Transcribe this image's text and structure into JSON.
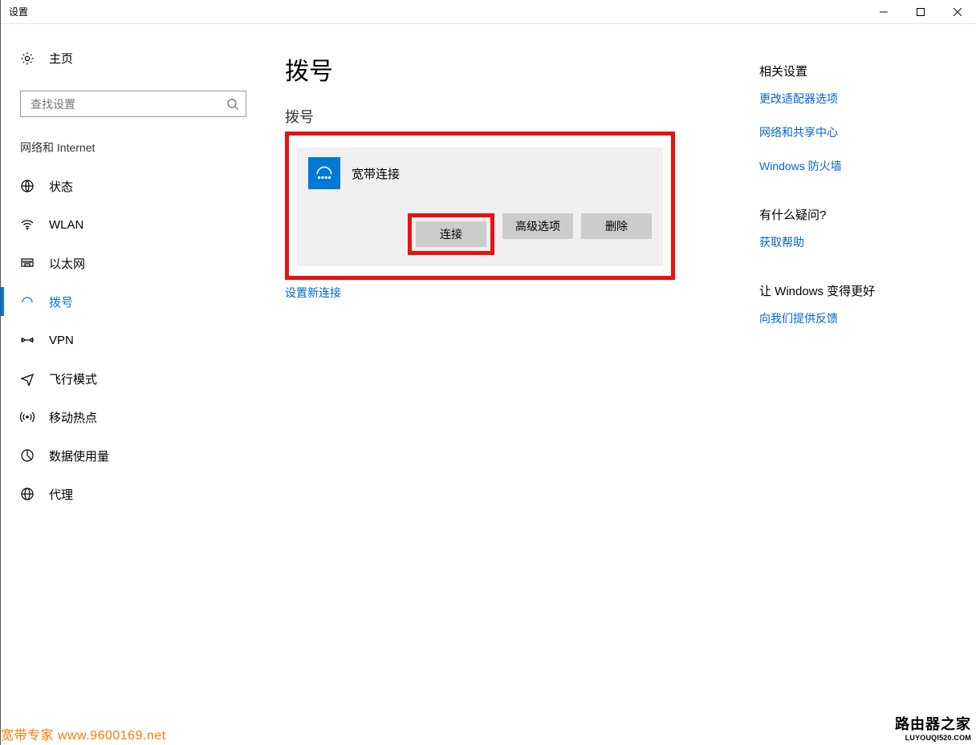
{
  "window": {
    "title": "设置"
  },
  "sidebar": {
    "home_label": "主页",
    "search_placeholder": "查找设置",
    "group_title": "网络和 Internet",
    "items": [
      {
        "label": "状态",
        "icon": "network-icon"
      },
      {
        "label": "WLAN",
        "icon": "wifi-icon"
      },
      {
        "label": "以太网",
        "icon": "ethernet-icon"
      },
      {
        "label": "拨号",
        "icon": "dialup-icon",
        "active": true
      },
      {
        "label": "VPN",
        "icon": "vpn-icon"
      },
      {
        "label": "飞行模式",
        "icon": "airplane-icon"
      },
      {
        "label": "移动热点",
        "icon": "hotspot-icon"
      },
      {
        "label": "数据使用量",
        "icon": "data-icon"
      },
      {
        "label": "代理",
        "icon": "proxy-icon"
      }
    ]
  },
  "main": {
    "page_title": "拨号",
    "section_title": "拨号",
    "connection": {
      "name": "宽带连接",
      "btn_connect": "连接",
      "btn_advanced": "高级选项",
      "btn_delete": "删除"
    },
    "setup_link": "设置新连接"
  },
  "right": {
    "related_heading": "相关设置",
    "related_links": [
      "更改适配器选项",
      "网络和共享中心",
      "Windows 防火墙"
    ],
    "question_heading": "有什么疑问?",
    "question_link": "获取帮助",
    "improve_heading": "让 Windows 变得更好",
    "improve_link": "向我们提供反馈"
  },
  "watermarks": {
    "left": "宽带专家 www.9600169.net",
    "right_big": "路由器之家",
    "right_small": "LUYOUQI520.COM"
  }
}
